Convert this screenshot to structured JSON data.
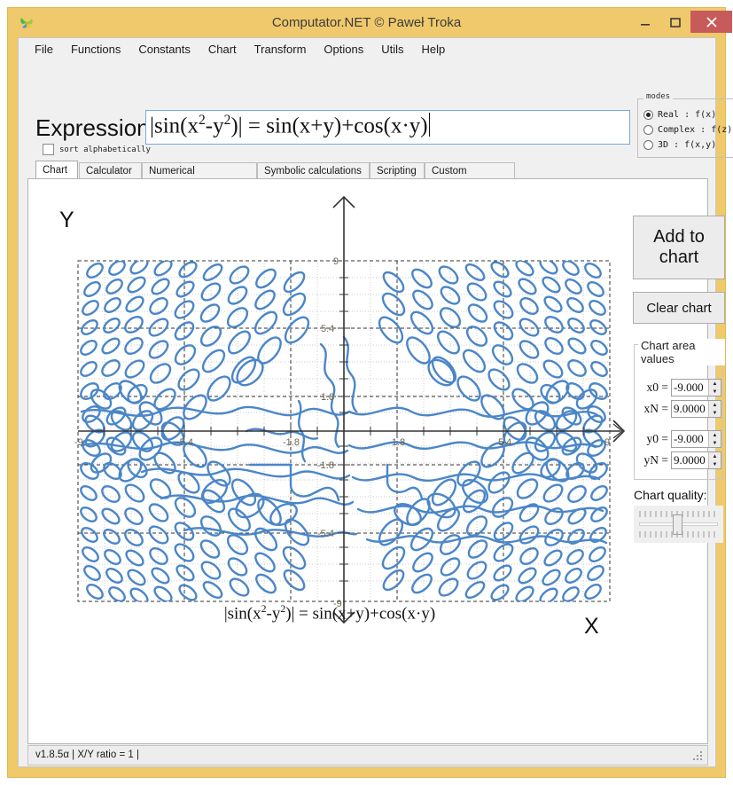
{
  "window": {
    "title": "Computator.NET © Paweł Troka",
    "icon": "butterfly-icon",
    "minimize": "–",
    "maximize": "▢",
    "close": "✕",
    "titlebar_color": "#f0c96c",
    "close_color": "#c75b5b"
  },
  "menu": {
    "items": [
      "File",
      "Functions",
      "Constants",
      "Chart",
      "Transform",
      "Options",
      "Utils",
      "Help"
    ]
  },
  "expression": {
    "label": "Expression:",
    "value": "|sin(x2-y2)| = sin(x+y)+cos(x·y)",
    "value_base": "|sin(x",
    "sup1": "2",
    "value_mid": "-y",
    "sup2": "2",
    "value_tail": ")| = sin(x+y)+cos(x·y)",
    "sort_alphabetically_label": "sort alphabetically",
    "sort_alphabetically_checked": false
  },
  "modes": {
    "legend": "modes",
    "options": [
      {
        "label": "Real : f(x)",
        "selected": true
      },
      {
        "label": "Complex : f(z)",
        "selected": false
      },
      {
        "label": "3D : f(x,y)",
        "selected": false
      }
    ]
  },
  "tabs": {
    "items": [
      {
        "label": "Chart",
        "active": true
      },
      {
        "label": "Calculator",
        "active": false
      },
      {
        "label": "Numerical calculations",
        "active": false
      },
      {
        "label": "Symbolic calculations",
        "active": false
      },
      {
        "label": "Scripting",
        "active": false
      },
      {
        "label": "Custom functions",
        "active": false
      }
    ]
  },
  "side_panel": {
    "add_to_chart": "Add to chart",
    "add_to_chart_line1": "Add to",
    "add_to_chart_line2": "chart",
    "clear_chart": "Clear chart",
    "area_group_legend": "Chart area values",
    "fields": [
      {
        "label": "x0 =",
        "value": "-9.000",
        "name": "x0"
      },
      {
        "label": "xN =",
        "value": "9.0000",
        "name": "xN"
      },
      {
        "label": "y0 =",
        "value": "-9.000",
        "name": "y0"
      },
      {
        "label": "yN =",
        "value": "9.0000",
        "name": "yN"
      }
    ],
    "quality_label": "Chart quality:",
    "quality_value": 50,
    "spin_up": "▲",
    "spin_down": "▼"
  },
  "statusbar": {
    "text": "v1.8.5α   | X/Y ratio = 1 |"
  },
  "chart_data": {
    "type": "line",
    "title": "",
    "caption": "|sin(x²-y²)| = sin(x+y)+cos(x·y)",
    "caption_base": "|sin(x",
    "caption_sup1": "2",
    "caption_mid": "-y",
    "caption_sup2": "2",
    "caption_tail": ")| = sin(x+y)+cos(x·y)",
    "equation": "|sin(x^2-y^2)| = sin(x+y)+cos(x*y)",
    "plot_kind": "implicit-contour",
    "xlabel": "X",
    "ylabel": "Y",
    "xlim": [
      -9,
      9
    ],
    "ylim": [
      -9,
      9
    ],
    "x_ticks": [
      -9,
      -5.4,
      -1.8,
      1.8,
      5.4,
      9
    ],
    "x_tick_labels": [
      "-9",
      "-5.4",
      "-1.8",
      "1.8",
      "5.4",
      "9"
    ],
    "y_ticks": [
      -9,
      -5.4,
      -1.8,
      1.8,
      5.4,
      9
    ],
    "y_tick_labels": [
      "-9",
      "-5.4",
      "-1.8",
      "1.8",
      "5.4",
      "9"
    ],
    "grid": true,
    "major_grid_step": 3.6,
    "minor_grid_step": 0.9,
    "legend": "none",
    "series_color": "#4a86c8",
    "axis_color": "#333333",
    "grid_major_color": "#333333",
    "grid_minor_color": "#cccccc",
    "tick_label_color": "#6b6450",
    "background": "#ffffff",
    "curve_line_width": 2.4,
    "contour_level": 0
  }
}
